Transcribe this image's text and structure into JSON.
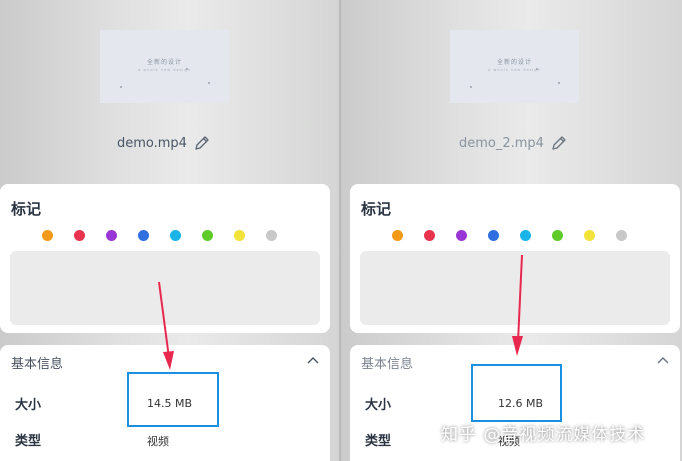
{
  "left_panel": {
    "thumbnail": {
      "title": "全新的设计",
      "subtitle": "a whole new design"
    },
    "filename": "demo.mp4",
    "edit_icon": "pencil-icon",
    "markers": {
      "title": "标记",
      "colors": [
        "#f39a1b",
        "#e8344e",
        "#9b36d6",
        "#2f6fe0",
        "#1ab4e8",
        "#5ecb2a",
        "#f2e33a",
        "#c8c8c8"
      ]
    },
    "info": {
      "title": "基本信息",
      "collapse_icon": "chevron-up-icon",
      "size_label": "大小",
      "size_value": "14.5 MB",
      "type_label": "类型",
      "type_value": "视频"
    }
  },
  "right_panel": {
    "thumbnail": {
      "title": "全新的设计",
      "subtitle": "a whole new design"
    },
    "filename": "demo_2.mp4",
    "edit_icon": "pencil-icon",
    "markers": {
      "title": "标记",
      "colors": [
        "#f39a1b",
        "#e8344e",
        "#9b36d6",
        "#2f6fe0",
        "#1ab4e8",
        "#5ecb2a",
        "#f2e33a",
        "#c8c8c8"
      ]
    },
    "info": {
      "title": "基本信息",
      "collapse_icon": "chevron-up-icon",
      "size_label": "大小",
      "size_value": "12.6 MB",
      "type_label": "类型",
      "type_value": "视频"
    }
  },
  "annotation": {
    "highlight_color": "#1b8fe0",
    "arrow_color": "#e8284e"
  },
  "watermark": "知乎 @音视频流媒体技术"
}
